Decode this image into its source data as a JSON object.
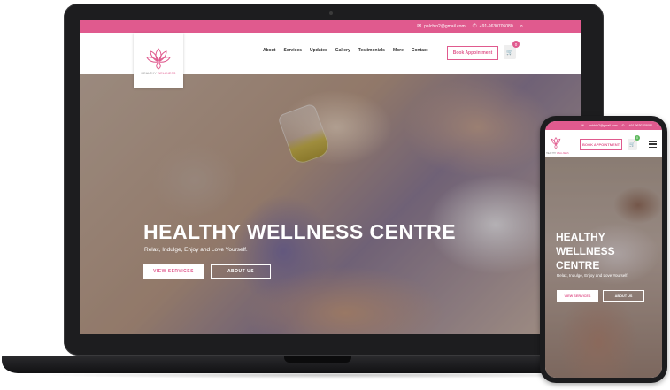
{
  "topbar": {
    "email": "palchin2@gmail.com",
    "phone": "+91-9630705080"
  },
  "logo": {
    "text_a": "HEALTHY",
    "text_b": "WELLNESS"
  },
  "nav": {
    "items": [
      "About",
      "Services",
      "Updates",
      "Gallery",
      "Testimonials",
      "More",
      "Contact"
    ],
    "book_label": "Book Appointment",
    "cart_count": "0"
  },
  "hero": {
    "title": "HEALTHY WELLNESS CENTRE",
    "subtitle": "Relax, Indulge, Enjoy and Love Yourself.",
    "btn_services": "VIEW SERVICES",
    "btn_about": "ABOUT US"
  },
  "mobile": {
    "topbar_email": "palchin2@gmail.com",
    "topbar_phone": "+91-9630705080",
    "book_label": "BOOK APPOINTMENT",
    "cart_count": "0",
    "title": "HEALTHY WELLNESS CENTRE",
    "subtitle": "Relax, Indulge, Enjoy and Love Yourself.",
    "btn_services": "VIEW SERVICES",
    "btn_about": "ABOUT US"
  },
  "colors": {
    "accent": "#e05a8e",
    "device": "#1d1d1f"
  },
  "icons": {
    "mail": "mail-icon",
    "phone": "phone-icon",
    "search": "search-icon",
    "cart": "cart-icon",
    "menu": "hamburger-menu-icon"
  }
}
